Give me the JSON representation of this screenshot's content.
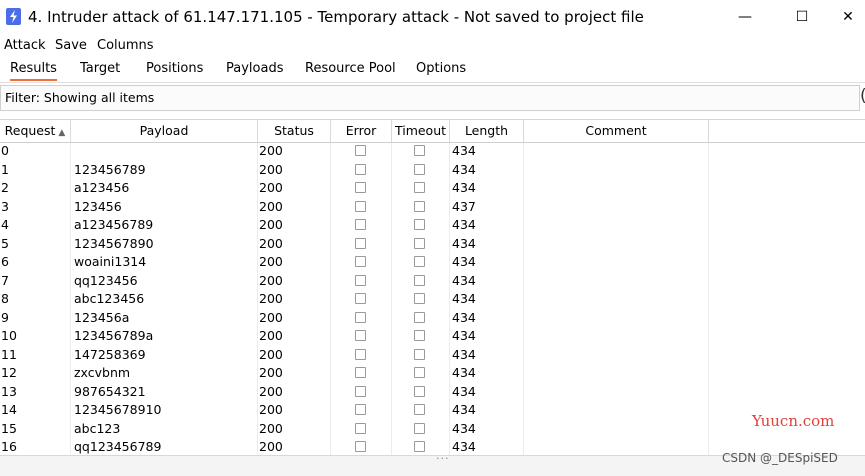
{
  "window": {
    "title": "4. Intruder attack of 61.147.171.105 - Temporary attack - Not saved to project file",
    "minimize": "—",
    "maximize": "☐",
    "close": "✕"
  },
  "menu": [
    "Attack",
    "Save",
    "Columns"
  ],
  "tabs": [
    "Results",
    "Target",
    "Positions",
    "Payloads",
    "Resource Pool",
    "Options"
  ],
  "active_tab": "Results",
  "filter": {
    "text": "Filter: Showing all items",
    "help_glyph": "("
  },
  "columns": [
    "Request",
    "Payload",
    "Status",
    "Error",
    "Timeout",
    "Length",
    "Comment"
  ],
  "rows": [
    {
      "request": "0",
      "payload": "",
      "status": "200",
      "error": false,
      "timeout": false,
      "length": "434"
    },
    {
      "request": "1",
      "payload": "123456789",
      "status": "200",
      "error": false,
      "timeout": false,
      "length": "434"
    },
    {
      "request": "2",
      "payload": "a123456",
      "status": "200",
      "error": false,
      "timeout": false,
      "length": "434"
    },
    {
      "request": "3",
      "payload": "123456",
      "status": "200",
      "error": false,
      "timeout": false,
      "length": "437"
    },
    {
      "request": "4",
      "payload": "a123456789",
      "status": "200",
      "error": false,
      "timeout": false,
      "length": "434"
    },
    {
      "request": "5",
      "payload": "1234567890",
      "status": "200",
      "error": false,
      "timeout": false,
      "length": "434"
    },
    {
      "request": "6",
      "payload": "woaini1314",
      "status": "200",
      "error": false,
      "timeout": false,
      "length": "434"
    },
    {
      "request": "7",
      "payload": "qq123456",
      "status": "200",
      "error": false,
      "timeout": false,
      "length": "434"
    },
    {
      "request": "8",
      "payload": "abc123456",
      "status": "200",
      "error": false,
      "timeout": false,
      "length": "434"
    },
    {
      "request": "9",
      "payload": "123456a",
      "status": "200",
      "error": false,
      "timeout": false,
      "length": "434"
    },
    {
      "request": "10",
      "payload": "123456789a",
      "status": "200",
      "error": false,
      "timeout": false,
      "length": "434"
    },
    {
      "request": "11",
      "payload": "147258369",
      "status": "200",
      "error": false,
      "timeout": false,
      "length": "434"
    },
    {
      "request": "12",
      "payload": "zxcvbnm",
      "status": "200",
      "error": false,
      "timeout": false,
      "length": "434"
    },
    {
      "request": "13",
      "payload": "987654321",
      "status": "200",
      "error": false,
      "timeout": false,
      "length": "434"
    },
    {
      "request": "14",
      "payload": "12345678910",
      "status": "200",
      "error": false,
      "timeout": false,
      "length": "434"
    },
    {
      "request": "15",
      "payload": "abc123",
      "status": "200",
      "error": false,
      "timeout": false,
      "length": "434"
    },
    {
      "request": "16",
      "payload": "qq123456789",
      "status": "200",
      "error": false,
      "timeout": false,
      "length": "434"
    }
  ],
  "grip": "···",
  "watermark": {
    "site": "Yuucn.com",
    "credit": "CSDN @_DESpiSED"
  }
}
